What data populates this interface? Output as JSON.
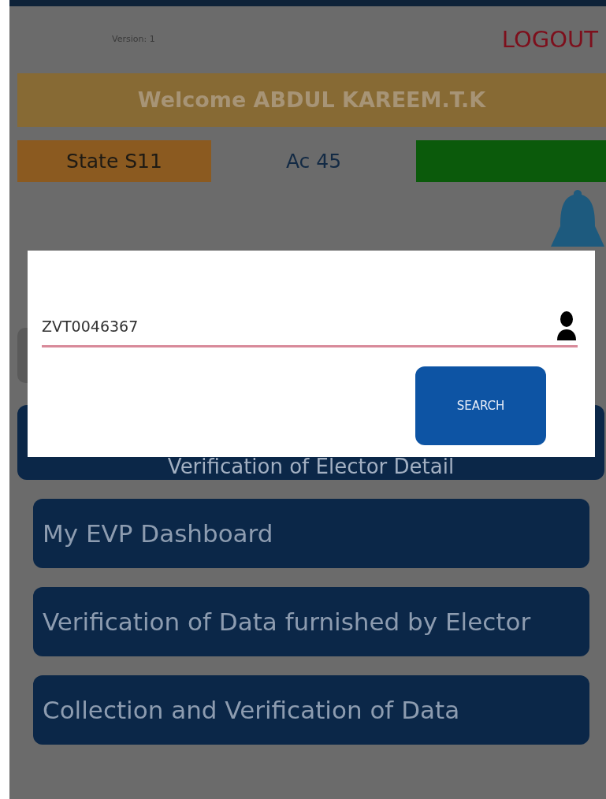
{
  "header": {
    "version": "Version: 1",
    "logout": "LOGOUT"
  },
  "welcome": "Welcome ABDUL KAREEM.T.K",
  "info": {
    "state": "State S11",
    "ac": "Ac 45"
  },
  "menu": [
    {
      "label": "Verification of Elector Detail",
      "kind": "wide"
    },
    {
      "label": "My EVP Dashboard",
      "kind": "inset"
    },
    {
      "label": "Verification of Data furnished by Elector",
      "kind": "inset"
    },
    {
      "label": "Collection and Verification of Data",
      "kind": "inset"
    }
  ],
  "dialog": {
    "value": "ZVT0046367",
    "button": "SEARCH"
  }
}
